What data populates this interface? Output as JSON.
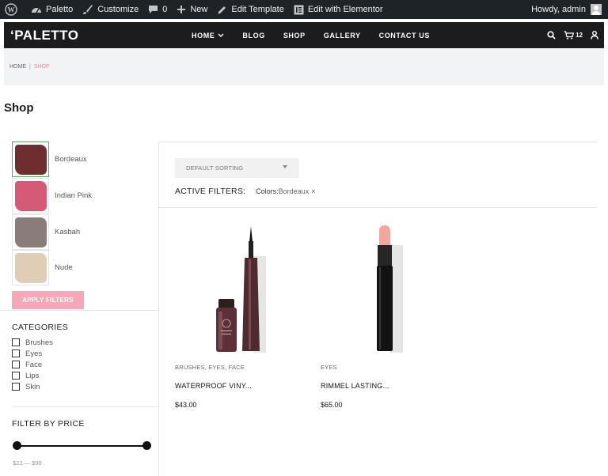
{
  "adminbar": {
    "site_name": "Paletto",
    "customize": "Customize",
    "comments_count": "0",
    "new_label": "New",
    "edit_template": "Edit Template",
    "edit_elementor": "Edit with Elementor",
    "howdy": "Howdy, admin"
  },
  "header": {
    "logo": "‘PALETTO",
    "nav": [
      {
        "label": "HOME",
        "has_dropdown": true
      },
      {
        "label": "BLOG"
      },
      {
        "label": "SHOP"
      },
      {
        "label": "GALLERY"
      },
      {
        "label": "CONTACT US"
      }
    ],
    "cart_count": "12"
  },
  "breadcrumb": {
    "home": "HOME",
    "separator": "|",
    "current": "SHOP"
  },
  "page_title": "Shop",
  "colors_filter": [
    {
      "label": "Bordeaux",
      "swatch": "#6e2e2f",
      "selected": true
    },
    {
      "label": "Indian Pink",
      "swatch": "#d45a78",
      "selected": false
    },
    {
      "label": "Kasbah",
      "swatch": "#8a7c7a",
      "selected": false
    },
    {
      "label": "Nude",
      "swatch": "#dfcdb6",
      "selected": false
    }
  ],
  "apply_filters_label": "APPLY FILTERS",
  "categories": {
    "heading": "CATEGORIES",
    "items": [
      "Brushes",
      "Eyes",
      "Face",
      "Lips",
      "Skin"
    ]
  },
  "price_filter": {
    "heading": "FILTER BY PRICE",
    "range_text": "$22 — $98",
    "min_fraction": 0.0,
    "max_fraction": 1.0
  },
  "sorting": {
    "selected": "DEFAULT SORTING"
  },
  "active_filters": {
    "label": "ACTIVE FILTERS:",
    "chip_key": "Colors:",
    "chip_value": "Bordeaux",
    "remove": "×"
  },
  "products": [
    {
      "categories": "BRUSHES, EYES, FACE",
      "name": "WATERPROOF VINY...",
      "price": "$43.00",
      "image": "eyeliner-image"
    },
    {
      "categories": "EYES",
      "name": "RIMMEL LASTING...",
      "price": "$65.00",
      "image": "lipstick-image"
    }
  ],
  "colors": {
    "adminbar_bg": "#1d2327",
    "header_bg": "#1c1c1e",
    "accent_pink": "#f7a8b8",
    "crumb_current": "#e88a9a",
    "selected_swatch_border": "#3fb950"
  }
}
